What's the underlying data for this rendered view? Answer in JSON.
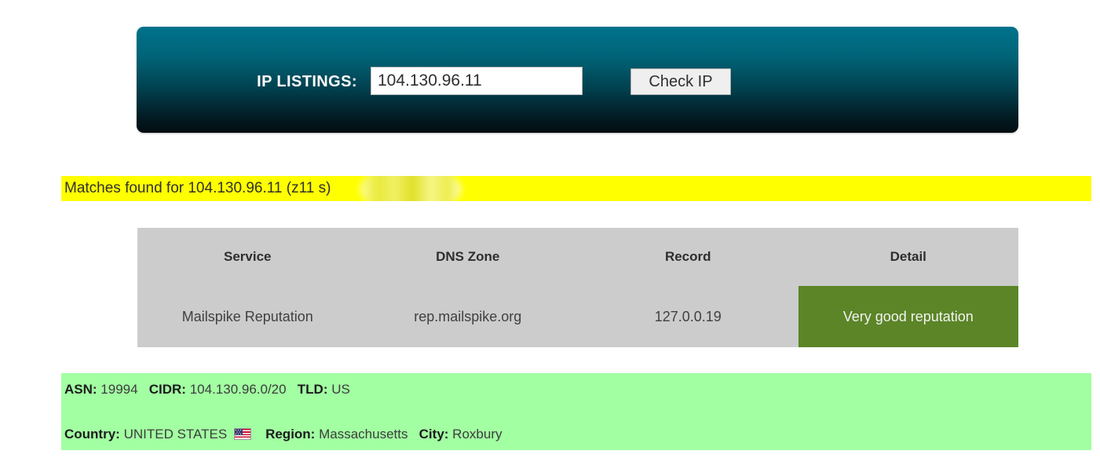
{
  "search_panel": {
    "label": "IP LISTINGS:",
    "input_value": "104.130.96.11",
    "input_placeholder": "",
    "button_label": "Check IP",
    "gradient_top": "#00728c",
    "gradient_bottom": "#020d11"
  },
  "matches_banner": {
    "text_before": "Matches found for 104.130.96.11 (z11",
    "text_after": "s)",
    "full_text": "Matches found for 104.130.96.11 (z11         s)",
    "background": "#ffff00"
  },
  "results_table": {
    "columns": [
      "Service",
      "DNS Zone",
      "Record",
      "Detail"
    ],
    "rows": [
      {
        "service": "Mailspike Reputation",
        "dns_zone": "rep.mailspike.org",
        "record": "127.0.0.19",
        "detail": "Very good reputation",
        "detail_color": "#5b8526"
      }
    ],
    "header_background": "#cccccc",
    "row_background": "#cccccc"
  },
  "geo_panel": {
    "background": "#a2ffa2",
    "asn_label": "ASN:",
    "asn_value": "19994",
    "cidr_label": "CIDR:",
    "cidr_value": "104.130.96.0/20",
    "tld_label": "TLD:",
    "tld_value": "US",
    "country_label": "Country:",
    "country_value": "UNITED STATES",
    "country_flag": "us-flag-icon",
    "region_label": "Region:",
    "region_value": "Massachusetts",
    "city_label": "City:",
    "city_value": "Roxbury"
  }
}
